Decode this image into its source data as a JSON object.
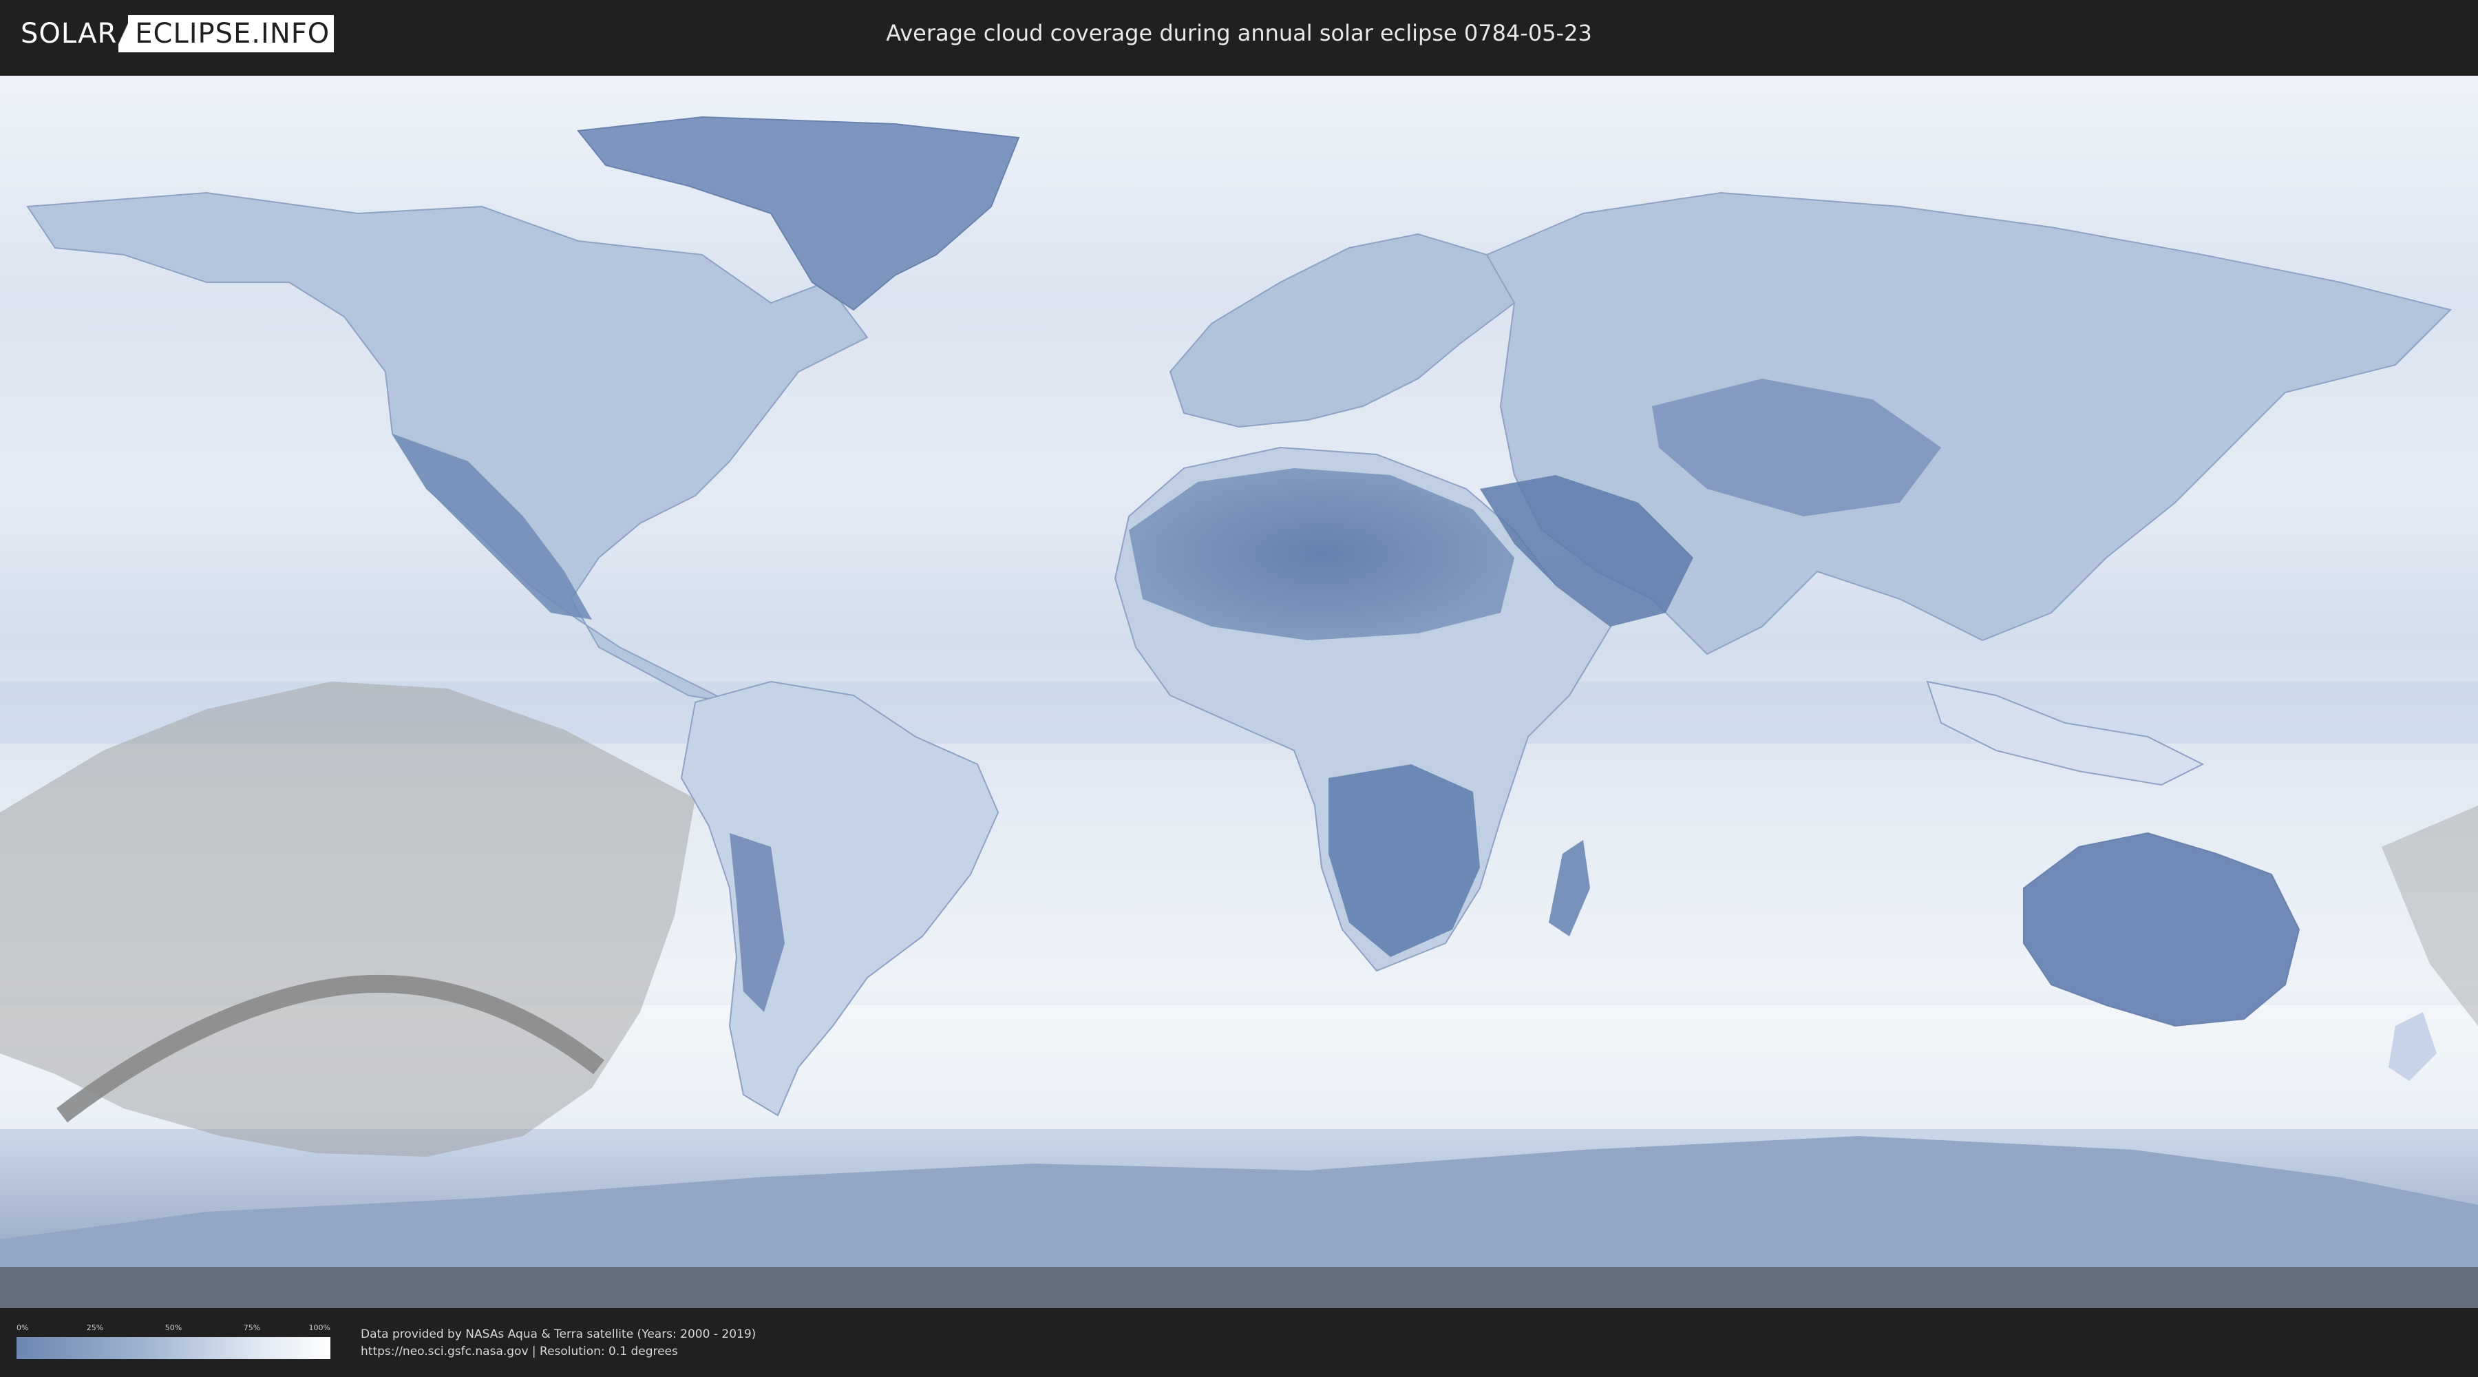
{
  "header": {
    "logo_left": "SOLAR",
    "logo_right": "ECLIPSE.INFO",
    "title": "Average cloud coverage during annual solar eclipse 0784-05-23"
  },
  "legend": {
    "ticks": [
      "0%",
      "25%",
      "50%",
      "75%",
      "100%"
    ],
    "color_low": "#6d87b2",
    "color_high": "#ffffff"
  },
  "footer": {
    "credit_line_1": "Data provided by NASAs Aqua & Terra satellite (Years: 2000 - 2019)",
    "credit_line_2": "https://neo.sci.gsfc.nasa.gov | Resolution: 0.1 degrees"
  },
  "colors": {
    "land_cloudy_low": "#5f7cab",
    "ocean_cloud": "#e6edf6",
    "eclipse_overlay": "#9a9a9a",
    "eclipse_path": "#8a8a8a"
  }
}
